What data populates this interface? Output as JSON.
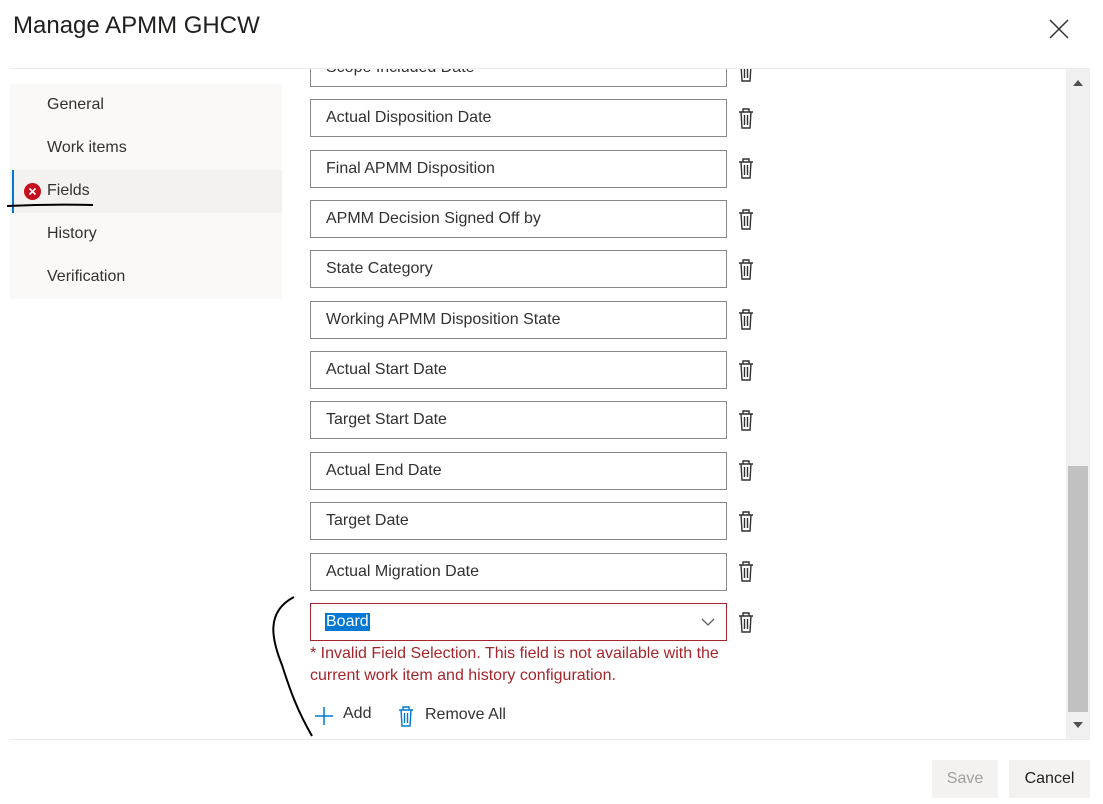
{
  "dialog": {
    "title": "Manage APMM GHCW"
  },
  "nav": {
    "items": [
      {
        "label": "General",
        "active": false,
        "has_error": false
      },
      {
        "label": "Work items",
        "active": false,
        "has_error": false
      },
      {
        "label": "Fields",
        "active": true,
        "has_error": true
      },
      {
        "label": "History",
        "active": false,
        "has_error": false
      },
      {
        "label": "Verification",
        "active": false,
        "has_error": false
      }
    ]
  },
  "fields": {
    "rows": [
      {
        "value": "Scope Included Date"
      },
      {
        "value": "Actual Disposition Date"
      },
      {
        "value": "Final APMM Disposition"
      },
      {
        "value": "APMM Decision Signed Off by"
      },
      {
        "value": "State Category"
      },
      {
        "value": "Working APMM Disposition State"
      },
      {
        "value": "Actual Start Date"
      },
      {
        "value": "Target Start Date"
      },
      {
        "value": "Actual End Date"
      },
      {
        "value": "Target Date"
      },
      {
        "value": "Actual Migration Date"
      }
    ],
    "invalid_row": {
      "value": "Board",
      "error_message": "* Invalid Field Selection. This field is not available with the current work item and history configuration."
    },
    "add_label": "Add",
    "remove_all_label": "Remove All"
  },
  "footer": {
    "save_label": "Save",
    "cancel_label": "Cancel",
    "save_enabled": false
  },
  "colors": {
    "accent": "#0078d4",
    "error": "#a4262c",
    "error_icon": "#c50f1f"
  },
  "icons": {
    "close": "close-icon",
    "error": "error-circle-icon",
    "delete": "trash-icon",
    "add": "plus-icon",
    "dropdown": "chevron-down-icon"
  }
}
